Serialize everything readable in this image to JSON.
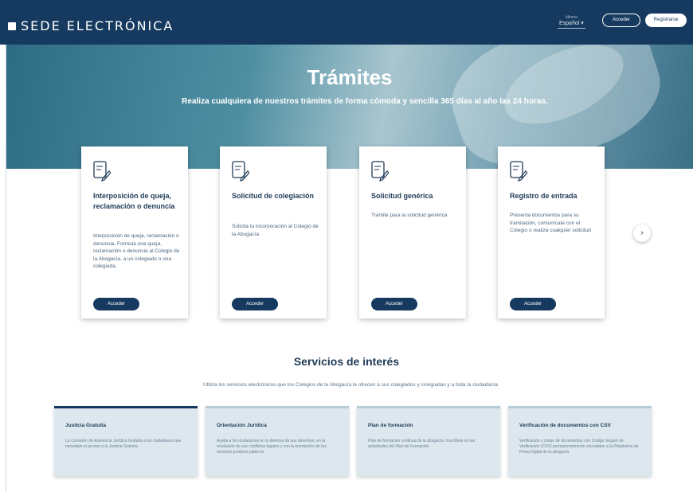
{
  "header": {
    "logo_text": "SEDE ELECTRÓNICA",
    "language_label": "Idioma",
    "language_value": "Español ▾",
    "login_label": "Acceder",
    "register_label": "Registrarse"
  },
  "hero": {
    "title": "Trámites",
    "subtitle": "Realiza cualquiera de nuestros trámites de forma cómoda y sencilla 365 días al año las 24 horas."
  },
  "cards": [
    {
      "title": "Interposición de queja, reclamación o denuncia",
      "description": "Interposición de queja, reclamación o denuncia. Formula una queja, reclamación o denuncia al Colegio de la Abogacía, a un colegiado o una colegiada.",
      "button": "Acceder"
    },
    {
      "title": "Solicitud de colegiación",
      "description": "Solicita tu incorporación al Colegio de la Abogacía",
      "button": "Acceder"
    },
    {
      "title": "Solicitud genérica",
      "description": "Trámite para la solicitud genérica",
      "button": "Acceder"
    },
    {
      "title": "Registro de entrada",
      "description": "Presenta documentos para su tramitación, comunícate con el Colegio o realiza cualquier solicitud",
      "button": "Acceder"
    }
  ],
  "carousel_next": "›",
  "services": {
    "title": "Servicios de interés",
    "subtitle": "Utiliza los servicios electrónicos que los Colegios de la Abogacía le ofrecen a sus colegiados y colegiadas y a toda la ciudadanía",
    "items": [
      {
        "title": "Justicia Gratuita",
        "description": "La Comisión de Asistencia Jurídica Gratuita a los ciudadanos que necesiten el acceso a la Justicia Gratuita"
      },
      {
        "title": "Orientación Jurídica",
        "description": "Ayuda a los ciudadanos en la defensa de sus derechos, en la resolución de sus conflictos legales y con la orientación de los servicios jurídicos públicos"
      },
      {
        "title": "Plan de formación",
        "description": "Plan de formación continua de la abogacía. Inscríbete en las actividades del Plan de Formación"
      },
      {
        "title": "Verificación de documentos con CSV",
        "description": "Verificación y cotejo de documentos con Código Seguro de Verificación (CSV) permanentemente vinculados a la Plataforma de Firma Digital de la abogacía"
      }
    ]
  },
  "colors": {
    "primary": "#163a5f",
    "card_bg": "#ffffff",
    "service_bg": "#dde7ee"
  }
}
